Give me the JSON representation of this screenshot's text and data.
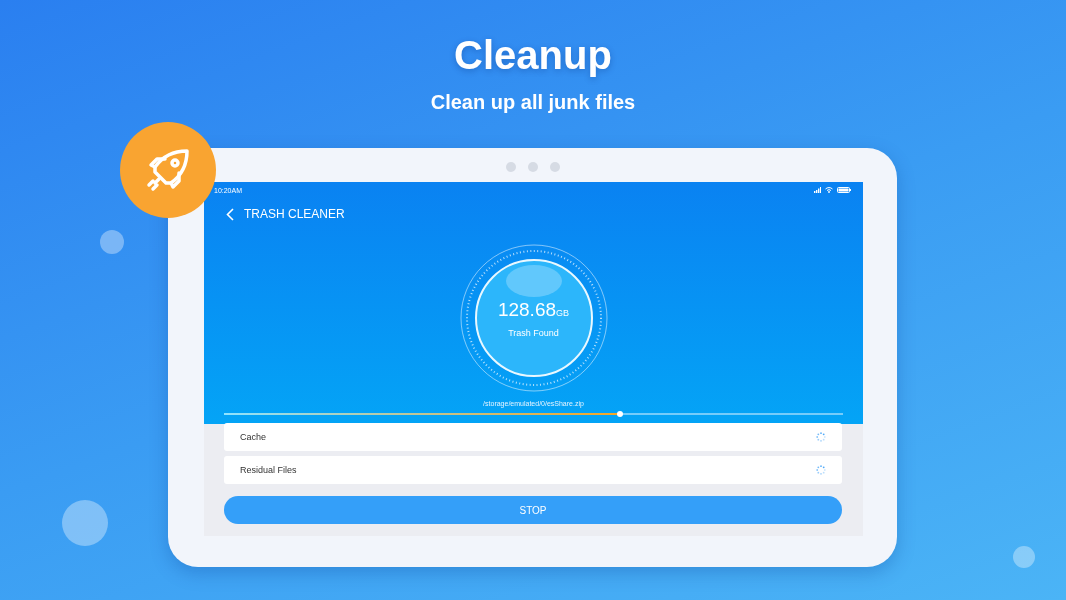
{
  "headline": "Cleanup",
  "subtitle": "Clean up all junk files",
  "status_bar": {
    "time": "10:20AM"
  },
  "app_bar": {
    "title": "TRASH CLEANER"
  },
  "gauge": {
    "amount": "128.68",
    "unit": "GB",
    "caption": "Trash Found"
  },
  "scan_path": "/storage/emulated/0/esShare.zip",
  "progress": {
    "level": 0.64
  },
  "items": [
    {
      "label": "Cache",
      "loading": true
    },
    {
      "label": "Residual Files",
      "loading": true
    }
  ],
  "stop_button": "STOP"
}
